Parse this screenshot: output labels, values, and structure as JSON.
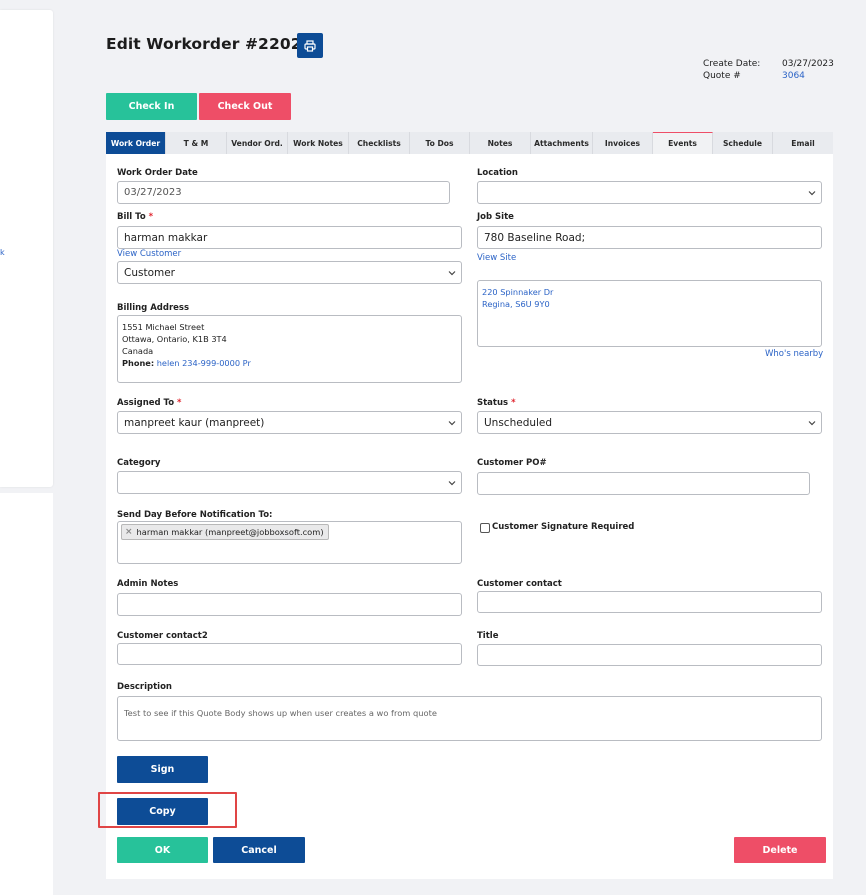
{
  "left_panel": {
    "stub_text": "k"
  },
  "header": {
    "title": "Edit Workorder #220282",
    "print_icon": "printer-icon",
    "create_date_label": "Create Date:",
    "create_date": "03/27/2023",
    "quote_label": "Quote #",
    "quote_number": "3064"
  },
  "actions": {
    "check_in": "Check In",
    "check_out": "Check Out"
  },
  "tabs": [
    {
      "label": "Work Order"
    },
    {
      "label": "T & M"
    },
    {
      "label": "Vendor Ord."
    },
    {
      "label": "Work Notes"
    },
    {
      "label": "Checklists"
    },
    {
      "label": "To Dos"
    },
    {
      "label": "Notes"
    },
    {
      "label": "Attachments"
    },
    {
      "label": "Invoices"
    },
    {
      "label": "Events"
    },
    {
      "label": "Schedule"
    },
    {
      "label": "Email"
    }
  ],
  "form": {
    "work_order_date": {
      "label": "Work Order Date",
      "value": "03/27/2023"
    },
    "location": {
      "label": "Location",
      "value": ""
    },
    "bill_to": {
      "label": "Bill To",
      "required": "*",
      "value": "harman makkar",
      "view_link": "View Customer",
      "type_value": "Customer"
    },
    "job_site": {
      "label": "Job Site",
      "value": "780 Baseline Road;",
      "view_link": "View Site"
    },
    "site_address": {
      "line1": "220 Spinnaker Dr",
      "line2": "Regina, S6U 9Y0",
      "nearby_link": "Who's nearby"
    },
    "billing_address": {
      "label": "Billing Address",
      "line1": "1551 Michael Street",
      "line2": "Ottawa, Ontario, K1B 3T4",
      "line3": "Canada",
      "phone_label": "Phone:",
      "phone_value": "helen 234-999-0000 Pr"
    },
    "assigned_to": {
      "label": "Assigned To",
      "required": "*",
      "value": "manpreet kaur (manpreet)"
    },
    "status": {
      "label": "Status",
      "required": "*",
      "value": "Unscheduled"
    },
    "category": {
      "label": "Category",
      "value": ""
    },
    "customer_po": {
      "label": "Customer PO#",
      "value": ""
    },
    "notification": {
      "label": "Send Day Before Notification To:",
      "chip": "harman makkar (manpreet@jobboxsoft.com)",
      "chip_remove": "×"
    },
    "signature_required": {
      "label": "Customer Signature Required",
      "checked": false
    },
    "admin_notes": {
      "label": "Admin Notes",
      "value": ""
    },
    "customer_contact": {
      "label": "Customer contact",
      "value": ""
    },
    "customer_contact2": {
      "label": "Customer contact2",
      "value": ""
    },
    "title": {
      "label": "Title",
      "value": ""
    },
    "description": {
      "label": "Description",
      "value": "Test to see if this Quote Body shows up when user creates a wo from quote"
    }
  },
  "buttons": {
    "sign": "Sign",
    "copy": "Copy",
    "ok": "OK",
    "cancel": "Cancel",
    "delete": "Delete"
  },
  "colors": {
    "primary": "#0d4c96",
    "success": "#27c29a",
    "danger": "#ee4e67",
    "link": "#2b63c6",
    "highlight": "#e04545"
  }
}
